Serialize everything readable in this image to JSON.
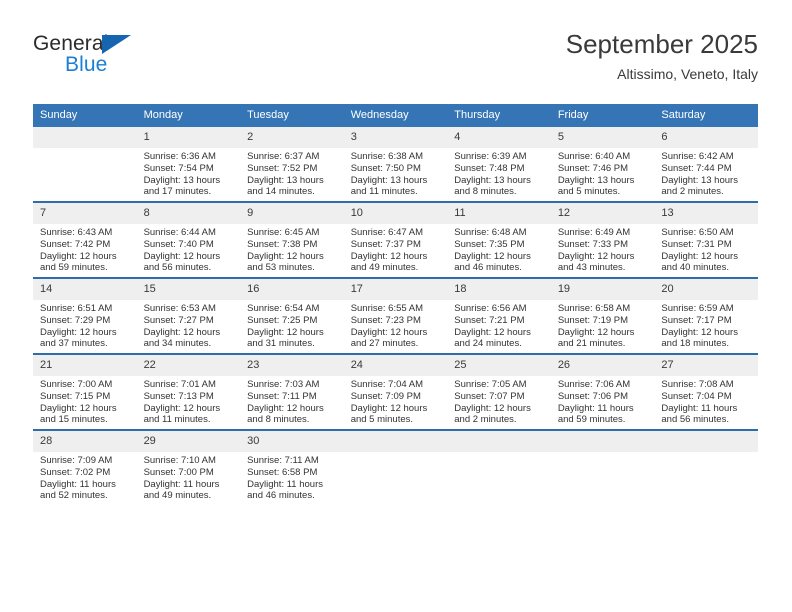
{
  "brand": {
    "name_top": "General",
    "name_bottom": "Blue",
    "accent_color": "#1565b0"
  },
  "header": {
    "title": "September 2025",
    "subtitle": "Altissimo, Veneto, Italy"
  },
  "theme": {
    "header_row_bg": "#3575b6",
    "row_divider": "#2f6cab",
    "daynum_bg": "#efefef",
    "text": "#333333"
  },
  "calendar": {
    "weekday_headers": [
      "Sunday",
      "Monday",
      "Tuesday",
      "Wednesday",
      "Thursday",
      "Friday",
      "Saturday"
    ],
    "weeks": [
      [
        {
          "day": "",
          "sunrise": "",
          "sunset": "",
          "daylight1": "",
          "daylight2": ""
        },
        {
          "day": "1",
          "sunrise": "Sunrise: 6:36 AM",
          "sunset": "Sunset: 7:54 PM",
          "daylight1": "Daylight: 13 hours",
          "daylight2": "and 17 minutes."
        },
        {
          "day": "2",
          "sunrise": "Sunrise: 6:37 AM",
          "sunset": "Sunset: 7:52 PM",
          "daylight1": "Daylight: 13 hours",
          "daylight2": "and 14 minutes."
        },
        {
          "day": "3",
          "sunrise": "Sunrise: 6:38 AM",
          "sunset": "Sunset: 7:50 PM",
          "daylight1": "Daylight: 13 hours",
          "daylight2": "and 11 minutes."
        },
        {
          "day": "4",
          "sunrise": "Sunrise: 6:39 AM",
          "sunset": "Sunset: 7:48 PM",
          "daylight1": "Daylight: 13 hours",
          "daylight2": "and 8 minutes."
        },
        {
          "day": "5",
          "sunrise": "Sunrise: 6:40 AM",
          "sunset": "Sunset: 7:46 PM",
          "daylight1": "Daylight: 13 hours",
          "daylight2": "and 5 minutes."
        },
        {
          "day": "6",
          "sunrise": "Sunrise: 6:42 AM",
          "sunset": "Sunset: 7:44 PM",
          "daylight1": "Daylight: 13 hours",
          "daylight2": "and 2 minutes."
        }
      ],
      [
        {
          "day": "7",
          "sunrise": "Sunrise: 6:43 AM",
          "sunset": "Sunset: 7:42 PM",
          "daylight1": "Daylight: 12 hours",
          "daylight2": "and 59 minutes."
        },
        {
          "day": "8",
          "sunrise": "Sunrise: 6:44 AM",
          "sunset": "Sunset: 7:40 PM",
          "daylight1": "Daylight: 12 hours",
          "daylight2": "and 56 minutes."
        },
        {
          "day": "9",
          "sunrise": "Sunrise: 6:45 AM",
          "sunset": "Sunset: 7:38 PM",
          "daylight1": "Daylight: 12 hours",
          "daylight2": "and 53 minutes."
        },
        {
          "day": "10",
          "sunrise": "Sunrise: 6:47 AM",
          "sunset": "Sunset: 7:37 PM",
          "daylight1": "Daylight: 12 hours",
          "daylight2": "and 49 minutes."
        },
        {
          "day": "11",
          "sunrise": "Sunrise: 6:48 AM",
          "sunset": "Sunset: 7:35 PM",
          "daylight1": "Daylight: 12 hours",
          "daylight2": "and 46 minutes."
        },
        {
          "day": "12",
          "sunrise": "Sunrise: 6:49 AM",
          "sunset": "Sunset: 7:33 PM",
          "daylight1": "Daylight: 12 hours",
          "daylight2": "and 43 minutes."
        },
        {
          "day": "13",
          "sunrise": "Sunrise: 6:50 AM",
          "sunset": "Sunset: 7:31 PM",
          "daylight1": "Daylight: 12 hours",
          "daylight2": "and 40 minutes."
        }
      ],
      [
        {
          "day": "14",
          "sunrise": "Sunrise: 6:51 AM",
          "sunset": "Sunset: 7:29 PM",
          "daylight1": "Daylight: 12 hours",
          "daylight2": "and 37 minutes."
        },
        {
          "day": "15",
          "sunrise": "Sunrise: 6:53 AM",
          "sunset": "Sunset: 7:27 PM",
          "daylight1": "Daylight: 12 hours",
          "daylight2": "and 34 minutes."
        },
        {
          "day": "16",
          "sunrise": "Sunrise: 6:54 AM",
          "sunset": "Sunset: 7:25 PM",
          "daylight1": "Daylight: 12 hours",
          "daylight2": "and 31 minutes."
        },
        {
          "day": "17",
          "sunrise": "Sunrise: 6:55 AM",
          "sunset": "Sunset: 7:23 PM",
          "daylight1": "Daylight: 12 hours",
          "daylight2": "and 27 minutes."
        },
        {
          "day": "18",
          "sunrise": "Sunrise: 6:56 AM",
          "sunset": "Sunset: 7:21 PM",
          "daylight1": "Daylight: 12 hours",
          "daylight2": "and 24 minutes."
        },
        {
          "day": "19",
          "sunrise": "Sunrise: 6:58 AM",
          "sunset": "Sunset: 7:19 PM",
          "daylight1": "Daylight: 12 hours",
          "daylight2": "and 21 minutes."
        },
        {
          "day": "20",
          "sunrise": "Sunrise: 6:59 AM",
          "sunset": "Sunset: 7:17 PM",
          "daylight1": "Daylight: 12 hours",
          "daylight2": "and 18 minutes."
        }
      ],
      [
        {
          "day": "21",
          "sunrise": "Sunrise: 7:00 AM",
          "sunset": "Sunset: 7:15 PM",
          "daylight1": "Daylight: 12 hours",
          "daylight2": "and 15 minutes."
        },
        {
          "day": "22",
          "sunrise": "Sunrise: 7:01 AM",
          "sunset": "Sunset: 7:13 PM",
          "daylight1": "Daylight: 12 hours",
          "daylight2": "and 11 minutes."
        },
        {
          "day": "23",
          "sunrise": "Sunrise: 7:03 AM",
          "sunset": "Sunset: 7:11 PM",
          "daylight1": "Daylight: 12 hours",
          "daylight2": "and 8 minutes."
        },
        {
          "day": "24",
          "sunrise": "Sunrise: 7:04 AM",
          "sunset": "Sunset: 7:09 PM",
          "daylight1": "Daylight: 12 hours",
          "daylight2": "and 5 minutes."
        },
        {
          "day": "25",
          "sunrise": "Sunrise: 7:05 AM",
          "sunset": "Sunset: 7:07 PM",
          "daylight1": "Daylight: 12 hours",
          "daylight2": "and 2 minutes."
        },
        {
          "day": "26",
          "sunrise": "Sunrise: 7:06 AM",
          "sunset": "Sunset: 7:06 PM",
          "daylight1": "Daylight: 11 hours",
          "daylight2": "and 59 minutes."
        },
        {
          "day": "27",
          "sunrise": "Sunrise: 7:08 AM",
          "sunset": "Sunset: 7:04 PM",
          "daylight1": "Daylight: 11 hours",
          "daylight2": "and 56 minutes."
        }
      ],
      [
        {
          "day": "28",
          "sunrise": "Sunrise: 7:09 AM",
          "sunset": "Sunset: 7:02 PM",
          "daylight1": "Daylight: 11 hours",
          "daylight2": "and 52 minutes."
        },
        {
          "day": "29",
          "sunrise": "Sunrise: 7:10 AM",
          "sunset": "Sunset: 7:00 PM",
          "daylight1": "Daylight: 11 hours",
          "daylight2": "and 49 minutes."
        },
        {
          "day": "30",
          "sunrise": "Sunrise: 7:11 AM",
          "sunset": "Sunset: 6:58 PM",
          "daylight1": "Daylight: 11 hours",
          "daylight2": "and 46 minutes."
        },
        {
          "day": "",
          "sunrise": "",
          "sunset": "",
          "daylight1": "",
          "daylight2": ""
        },
        {
          "day": "",
          "sunrise": "",
          "sunset": "",
          "daylight1": "",
          "daylight2": ""
        },
        {
          "day": "",
          "sunrise": "",
          "sunset": "",
          "daylight1": "",
          "daylight2": ""
        },
        {
          "day": "",
          "sunrise": "",
          "sunset": "",
          "daylight1": "",
          "daylight2": ""
        }
      ]
    ]
  }
}
